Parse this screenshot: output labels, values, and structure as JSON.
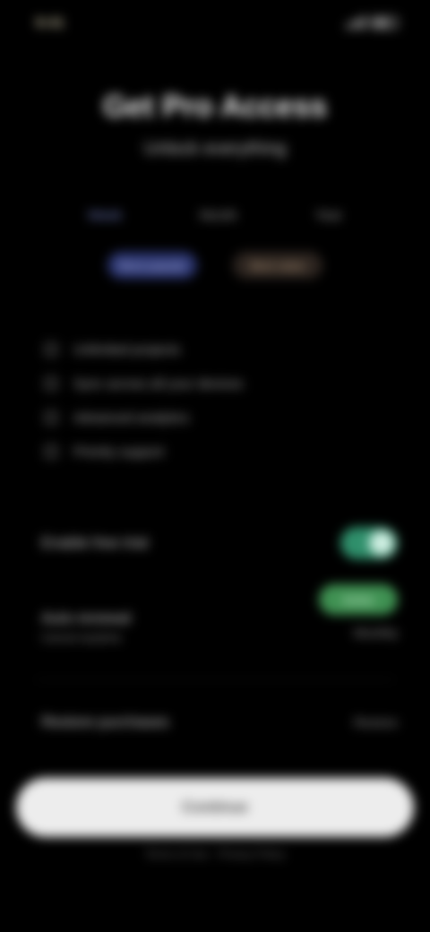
{
  "status_bar": {
    "time": "9:41"
  },
  "header": {
    "title": "Get Pro Access",
    "subtitle": "Unlock everything"
  },
  "tiers": [
    {
      "label": "Week",
      "active": true
    },
    {
      "label": "Month",
      "active": false
    },
    {
      "label": "Year",
      "active": false
    }
  ],
  "chips": {
    "primary": "Most popular",
    "secondary": "Best value"
  },
  "features": [
    "Unlimited projects",
    "Sync across all your devices",
    "Advanced analytics",
    "Priority support"
  ],
  "settings": {
    "free_trial": {
      "label": "Enable free trial"
    },
    "auto_renew": {
      "label": "Auto-renewal",
      "sub": "Cancel anytime",
      "badge": "Active",
      "value": "Monthly"
    },
    "restore": {
      "label": "Restore purchases",
      "value": "Restore"
    }
  },
  "cta": {
    "label": "Continue"
  },
  "footer": {
    "note": "Terms of Use · Privacy Policy"
  },
  "colors": {
    "background": "#000000",
    "accent_blue": "#2b3570",
    "accent_green": "#3f9152",
    "toggle_green": "#2f8f6b",
    "cta_bg": "#ededed"
  }
}
